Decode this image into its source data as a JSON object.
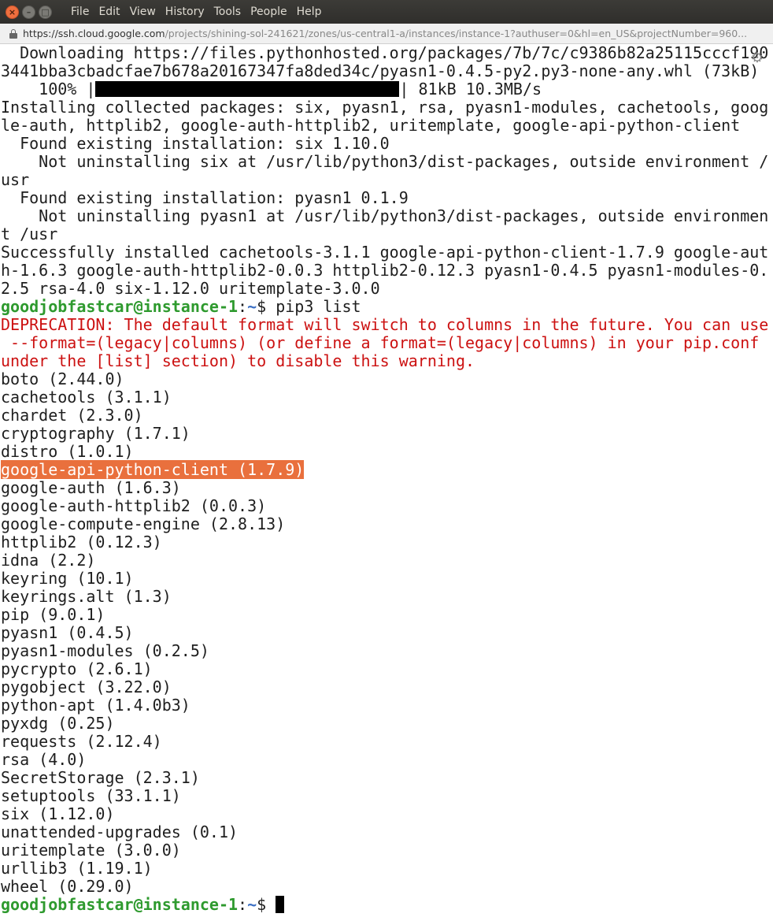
{
  "window": {
    "menu": [
      "File",
      "Edit",
      "View",
      "History",
      "Tools",
      "People",
      "Help"
    ]
  },
  "urlbar": {
    "host": "https://ssh.cloud.google.com",
    "rest": "/projects/shining-sol-241621/zones/us-central1-a/instances/instance-1?authuser=0&hl=en_US&projectNumber=960..."
  },
  "terminal": {
    "lines": [
      {
        "t": "  Downloading https://files.pythonhosted.org/packages/7b/7c/c9386b82a25115cccf190"
      },
      {
        "t": "3441bba3cbadcfae7b678a20167347fa8ded34c/pyasn1-0.4.5-py2.py3-none-any.whl (73kB)"
      },
      {
        "t": "progress",
        "pre": "    100% |",
        "post": "| 81kB 10.3MB/s",
        "percent": 100
      },
      {
        "t": "Installing collected packages: six, pyasn1, rsa, pyasn1-modules, cachetools, goog"
      },
      {
        "t": "le-auth, httplib2, google-auth-httplib2, uritemplate, google-api-python-client"
      },
      {
        "t": "  Found existing installation: six 1.10.0"
      },
      {
        "t": "    Not uninstalling six at /usr/lib/python3/dist-packages, outside environment /"
      },
      {
        "t": "usr"
      },
      {
        "t": "  Found existing installation: pyasn1 0.1.9"
      },
      {
        "t": "    Not uninstalling pyasn1 at /usr/lib/python3/dist-packages, outside environmen"
      },
      {
        "t": "t /usr"
      },
      {
        "t": "Successfully installed cachetools-3.1.1 google-api-python-client-1.7.9 google-aut"
      },
      {
        "t": "h-1.6.3 google-auth-httplib2-0.0.3 httplib2-0.12.3 pyasn1-0.4.5 pyasn1-modules-0."
      },
      {
        "t": "2.5 rsa-4.0 six-1.12.0 uritemplate-3.0.0"
      },
      {
        "t": "prompt",
        "user": "goodjobfastcar@instance-1",
        "sep": ":",
        "path": "~",
        "cmd": "$ pip3 list"
      },
      {
        "t": "warn",
        "text": "DEPRECATION: The default format will switch to columns in the future. You can use"
      },
      {
        "t": "warn",
        "text": " --format=(legacy|columns) (or define a format=(legacy|columns) in your pip.conf"
      },
      {
        "t": "warn",
        "text": "under the [list] section) to disable this warning."
      },
      {
        "t": "boto (2.44.0)"
      },
      {
        "t": "cachetools (3.1.1)"
      },
      {
        "t": "chardet (2.3.0)"
      },
      {
        "t": "cryptography (1.7.1)"
      },
      {
        "t": "distro (1.0.1)"
      },
      {
        "t": "hl",
        "text": "google-api-python-client (1.7.9)"
      },
      {
        "t": "google-auth (1.6.3)"
      },
      {
        "t": "google-auth-httplib2 (0.0.3)"
      },
      {
        "t": "google-compute-engine (2.8.13)"
      },
      {
        "t": "httplib2 (0.12.3)"
      },
      {
        "t": "idna (2.2)"
      },
      {
        "t": "keyring (10.1)"
      },
      {
        "t": "keyrings.alt (1.3)"
      },
      {
        "t": "pip (9.0.1)"
      },
      {
        "t": "pyasn1 (0.4.5)"
      },
      {
        "t": "pyasn1-modules (0.2.5)"
      },
      {
        "t": "pycrypto (2.6.1)"
      },
      {
        "t": "pygobject (3.22.0)"
      },
      {
        "t": "python-apt (1.4.0b3)"
      },
      {
        "t": "pyxdg (0.25)"
      },
      {
        "t": "requests (2.12.4)"
      },
      {
        "t": "rsa (4.0)"
      },
      {
        "t": "SecretStorage (2.3.1)"
      },
      {
        "t": "setuptools (33.1.1)"
      },
      {
        "t": "six (1.12.0)"
      },
      {
        "t": "unattended-upgrades (0.1)"
      },
      {
        "t": "uritemplate (3.0.0)"
      },
      {
        "t": "urllib3 (1.19.1)"
      },
      {
        "t": "wheel (0.29.0)"
      },
      {
        "t": "prompt",
        "user": "goodjobfastcar@instance-1",
        "sep": ":",
        "path": "~",
        "cmd": "$ ",
        "cursor": true
      }
    ]
  },
  "icons": {
    "settings": "gear-icon"
  }
}
